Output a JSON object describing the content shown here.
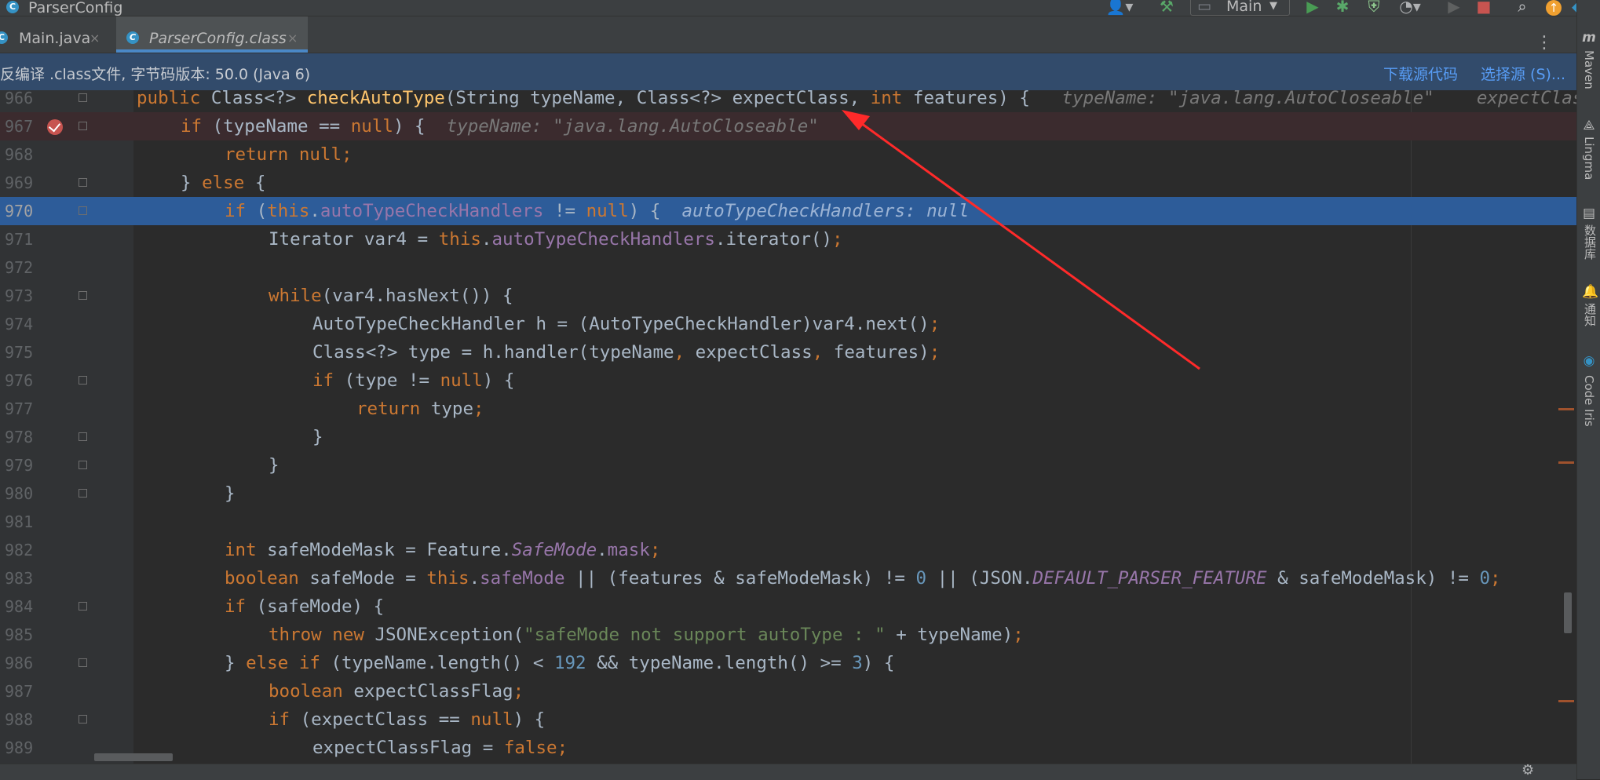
{
  "window": {
    "title": "ParserConfig"
  },
  "toolbar": {
    "run_config": "Main",
    "run_config_arrow": "▼"
  },
  "tabs": [
    {
      "label": "Main.java",
      "icon": "class-icon",
      "active": false
    },
    {
      "label": "ParserConfig.class",
      "icon": "class-icon",
      "active": true
    }
  ],
  "tab_close_glyph": "×",
  "banner": {
    "message": "反编译 .class文件, 字节码版本: 50.0 (Java 6)",
    "download_sources": "下载源代码",
    "choose_sources": "选择源 (S)..."
  },
  "code_lines": [
    {
      "ln": "966",
      "text": "public Class<?> checkAutoType(String typeName, Class<?> expectClass, int features) {",
      "hint": "typeName: \"java.lang.AutoCloseable\"    expectClass: null"
    },
    {
      "ln": "967",
      "text": "if (typeName == null) {",
      "hint": "typeName: \"java.lang.AutoCloseable\""
    },
    {
      "ln": "968",
      "text": "return null;"
    },
    {
      "ln": "969",
      "text": "} else {"
    },
    {
      "ln": "970",
      "text": "if (this.autoTypeCheckHandlers != null) {",
      "hint": "autoTypeCheckHandlers: null"
    },
    {
      "ln": "971",
      "text": "Iterator var4 = this.autoTypeCheckHandlers.iterator();"
    },
    {
      "ln": "972",
      "text": ""
    },
    {
      "ln": "973",
      "text": "while(var4.hasNext()) {"
    },
    {
      "ln": "974",
      "text": "AutoTypeCheckHandler h = (AutoTypeCheckHandler)var4.next();"
    },
    {
      "ln": "975",
      "text": "Class<?> type = h.handler(typeName, expectClass, features);"
    },
    {
      "ln": "976",
      "text": "if (type != null) {"
    },
    {
      "ln": "977",
      "text": "return type;"
    },
    {
      "ln": "978",
      "text": "}"
    },
    {
      "ln": "979",
      "text": "}"
    },
    {
      "ln": "980",
      "text": "}"
    },
    {
      "ln": "981",
      "text": ""
    },
    {
      "ln": "982",
      "text": "int safeModeMask = Feature.SafeMode.mask;"
    },
    {
      "ln": "983",
      "text": "boolean safeMode = this.safeMode || (features & safeModeMask) != 0 || (JSON.DEFAULT_PARSER_FEATURE & safeModeMask) != 0;"
    },
    {
      "ln": "984",
      "text": "if (safeMode) {"
    },
    {
      "ln": "985",
      "text": "throw new JSONException(\"safeMode not support autoType : \" + typeName);"
    },
    {
      "ln": "986",
      "text": "} else if (typeName.length() < 192 && typeName.length() >= 3) {"
    },
    {
      "ln": "987",
      "text": "boolean expectClassFlag;"
    },
    {
      "ln": "988",
      "text": "if (expectClass == null) {"
    },
    {
      "ln": "989",
      "text": "expectClassFlag = false;"
    }
  ],
  "breakpoint_line": "967",
  "execution_line": "970",
  "annotation_arrow": {
    "color": "#ff2a2a"
  },
  "right_sidebar": [
    {
      "label": "Maven",
      "icon": "maven-icon"
    },
    {
      "label": "Lingma",
      "icon": "lingma-icon"
    },
    {
      "label": "数据库",
      "icon": "database-icon"
    },
    {
      "label": "通知",
      "icon": "bell-icon"
    },
    {
      "label": "Code Iris",
      "icon": "code-iris-icon"
    }
  ],
  "colors": {
    "keyword": "#cc7832",
    "method": "#ffc66d",
    "field": "#9876aa",
    "number": "#6897bb",
    "string": "#6a8759",
    "execution_highlight": "#2d5c99",
    "breakpoint_line": "#3b2b2e"
  }
}
